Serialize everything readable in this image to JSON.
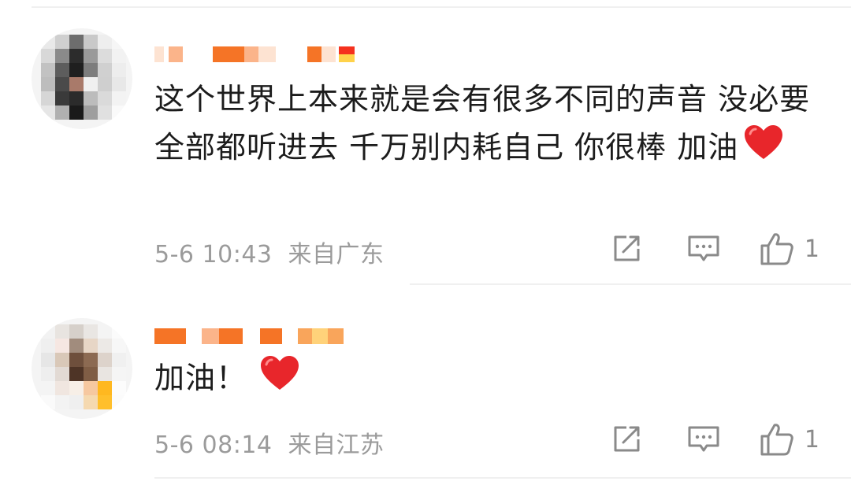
{
  "comments": [
    {
      "text": "这个世界上本来就是会有很多不同的声音 没必要全部都听进去 千万别内耗自己 你很棒 加油",
      "emoji": "heart-emoji",
      "date": "5-6 10:43",
      "location": "来自广东",
      "like_count": "1"
    },
    {
      "text": "加油！",
      "emoji": "heart-emoji",
      "date": "5-6 08:14",
      "location": "来自江苏",
      "like_count": "1"
    }
  ],
  "icons": {
    "repost": "repost-icon",
    "reply": "comment-icon",
    "like": "thumbs-up-icon"
  },
  "colors": {
    "background": "#ffffff",
    "text": "#1c1c1c",
    "meta": "#9b9b9b",
    "icon": "#8a8a8a",
    "heart": "#e8262b",
    "username_orange": "#f56a00"
  }
}
